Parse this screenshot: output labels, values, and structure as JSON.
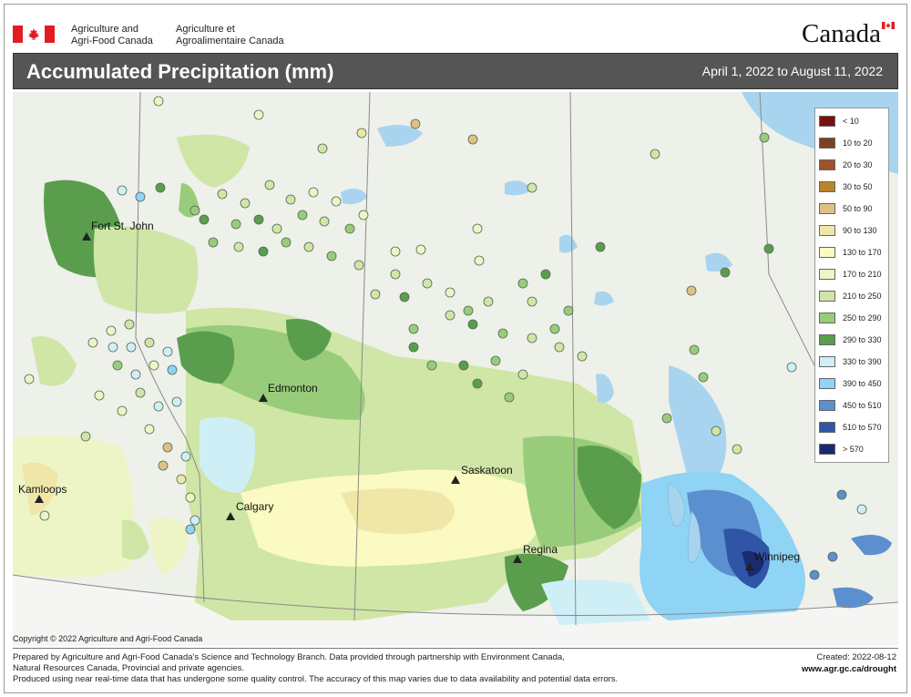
{
  "header": {
    "department_en_line1": "Agriculture and",
    "department_en_line2": "Agri-Food Canada",
    "department_fr_line1": "Agriculture et",
    "department_fr_line2": "Agroalimentaire Canada",
    "wordmark": "Canada",
    "title": "Accumulated Precipitation (mm)",
    "date_range": "April 1, 2022 to August 11, 2022"
  },
  "map": {
    "cities": [
      {
        "name": "Fort St. John"
      },
      {
        "name": "Edmonton"
      },
      {
        "name": "Kamloops"
      },
      {
        "name": "Calgary"
      },
      {
        "name": "Saskatoon"
      },
      {
        "name": "Regina"
      },
      {
        "name": "Winnipeg"
      }
    ],
    "colors": {
      "water": "#a8d4ef",
      "land_base": "#eef0ea",
      "boundary": "#8a8a8a"
    }
  },
  "legend": {
    "items": [
      {
        "label": "< 10",
        "color": "#7a0f0f"
      },
      {
        "label": "10 to 20",
        "color": "#7b4221"
      },
      {
        "label": "20 to 30",
        "color": "#a0522d"
      },
      {
        "label": "30 to 50",
        "color": "#b8852e"
      },
      {
        "label": "50 to 90",
        "color": "#dcc285"
      },
      {
        "label": "90 to 130",
        "color": "#efe6a8"
      },
      {
        "label": "130 to 170",
        "color": "#fafac2"
      },
      {
        "label": "170 to 210",
        "color": "#edf5c7"
      },
      {
        "label": "210 to 250",
        "color": "#cfe6a6"
      },
      {
        "label": "250 to 290",
        "color": "#99cc7a"
      },
      {
        "label": "290 to 330",
        "color": "#5a9e4d"
      },
      {
        "label": "330 to 390",
        "color": "#cfeff7"
      },
      {
        "label": "390 to 450",
        "color": "#8fd3f5"
      },
      {
        "label": "450 to 510",
        "color": "#5b8fcf"
      },
      {
        "label": "510 to 570",
        "color": "#2f55a6"
      },
      {
        "label": "> 570",
        "color": "#1a2a6e"
      }
    ]
  },
  "footer": {
    "copyright": "Copyright © 2022 Agriculture and Agri-Food Canada",
    "note_line1": "Prepared by Agriculture and Agri-Food Canada's Science and Technology Branch. Data provided through partnership with Environment Canada,",
    "note_line2": "Natural Resources Canada, Provincial and private agencies.",
    "note_line3": "Produced using near real-time data that has undergone some quality control. The accuracy of this map varies due to data availability and potential data errors.",
    "created": "Created: 2022-08-12",
    "url": "www.agr.gc.ca/drought"
  }
}
